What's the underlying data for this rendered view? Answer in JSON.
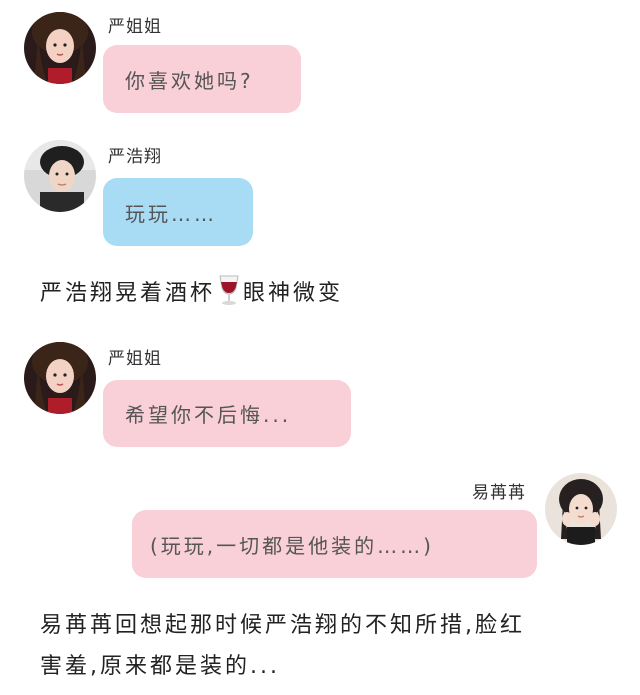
{
  "messages": [
    {
      "sender": "严姐姐",
      "text": "你喜欢她吗?",
      "bubble_color": "#f9d0d7"
    },
    {
      "sender": "严浩翔",
      "text": "玩玩……",
      "bubble_color": "#a8dcf5"
    },
    {
      "sender": "严姐姐",
      "text": "希望你不后悔...",
      "bubble_color": "#f9d0d7"
    },
    {
      "sender": "易苒苒",
      "text": "(玩玩,一切都是他装的……)",
      "bubble_color": "#f9d0d7"
    }
  ],
  "narration": [
    {
      "before": "严浩翔晃着酒杯",
      "icon": "wine-glass-emoji",
      "after": "眼神微变"
    },
    {
      "line1": "易苒苒回想起那时候严浩翔的不知所措,脸红",
      "line2": "害羞,原来都是装的..."
    }
  ]
}
